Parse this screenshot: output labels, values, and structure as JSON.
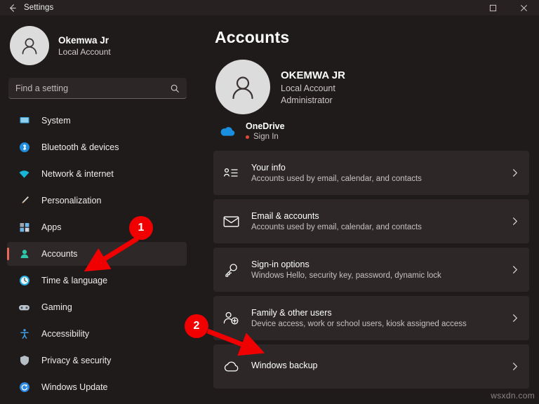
{
  "window": {
    "title": "Settings",
    "back_icon": "back-arrow-icon",
    "maximize_icon": "maximize-icon",
    "close_icon": "close-icon"
  },
  "sidebar": {
    "profile": {
      "name": "Okemwa Jr",
      "account_type": "Local Account",
      "avatar_icon": "person-avatar-icon"
    },
    "search": {
      "placeholder": "Find a setting",
      "value": "",
      "icon": "search-icon"
    },
    "items": [
      {
        "label": "System",
        "icon": "monitor-icon",
        "color": "#3aa0d8",
        "active": false
      },
      {
        "label": "Bluetooth & devices",
        "icon": "bluetooth-icon",
        "color": "#1e8de0",
        "active": false
      },
      {
        "label": "Network & internet",
        "icon": "wifi-icon",
        "color": "#17b6d6",
        "active": false
      },
      {
        "label": "Personalization",
        "icon": "paintbrush-icon",
        "color": "#e0a33c",
        "active": false
      },
      {
        "label": "Apps",
        "icon": "apps-icon",
        "color": "#6fb6e8",
        "active": false
      },
      {
        "label": "Accounts",
        "icon": "accounts-icon",
        "color": "#2fc6a8",
        "active": true
      },
      {
        "label": "Time & language",
        "icon": "clock-icon",
        "color": "#29aee0",
        "active": false
      },
      {
        "label": "Gaming",
        "icon": "gamepad-icon",
        "color": "#b9c3cc",
        "active": false
      },
      {
        "label": "Accessibility",
        "icon": "accessibility-icon",
        "color": "#3fa0e8",
        "active": false
      },
      {
        "label": "Privacy & security",
        "icon": "shield-icon",
        "color": "#b6bec6",
        "active": false
      },
      {
        "label": "Windows Update",
        "icon": "update-icon",
        "color": "#2b87e0",
        "active": false
      }
    ],
    "active_accent": "#e8695c"
  },
  "main": {
    "page_title": "Accounts",
    "account": {
      "name": "OKEMWA JR",
      "type": "Local Account",
      "role": "Administrator",
      "avatar_icon": "person-avatar-icon"
    },
    "onedrive": {
      "name": "OneDrive",
      "status": "Sign In",
      "icon": "onedrive-cloud-icon",
      "status_dot_color": "#e04a3a"
    },
    "cards": [
      {
        "title": "Your info",
        "desc": "Accounts used by email, calendar, and contacts",
        "icon": "your-info-icon",
        "chevron": "chevron-right-icon"
      },
      {
        "title": "Email & accounts",
        "desc": "Accounts used by email, calendar, and contacts",
        "icon": "envelope-icon",
        "chevron": "chevron-right-icon"
      },
      {
        "title": "Sign-in options",
        "desc": "Windows Hello, security key, password, dynamic lock",
        "icon": "key-icon",
        "chevron": "chevron-right-icon"
      },
      {
        "title": "Family & other users",
        "desc": "Device access, work or school users, kiosk assigned access",
        "icon": "family-users-icon",
        "chevron": "chevron-right-icon"
      },
      {
        "title": "Windows backup",
        "desc": "",
        "icon": "backup-icon",
        "chevron": "chevron-right-icon"
      }
    ]
  },
  "annotations": {
    "color": "#f00000",
    "badges": [
      {
        "label": "1"
      },
      {
        "label": "2"
      }
    ]
  },
  "watermark": "wsxdn.com"
}
